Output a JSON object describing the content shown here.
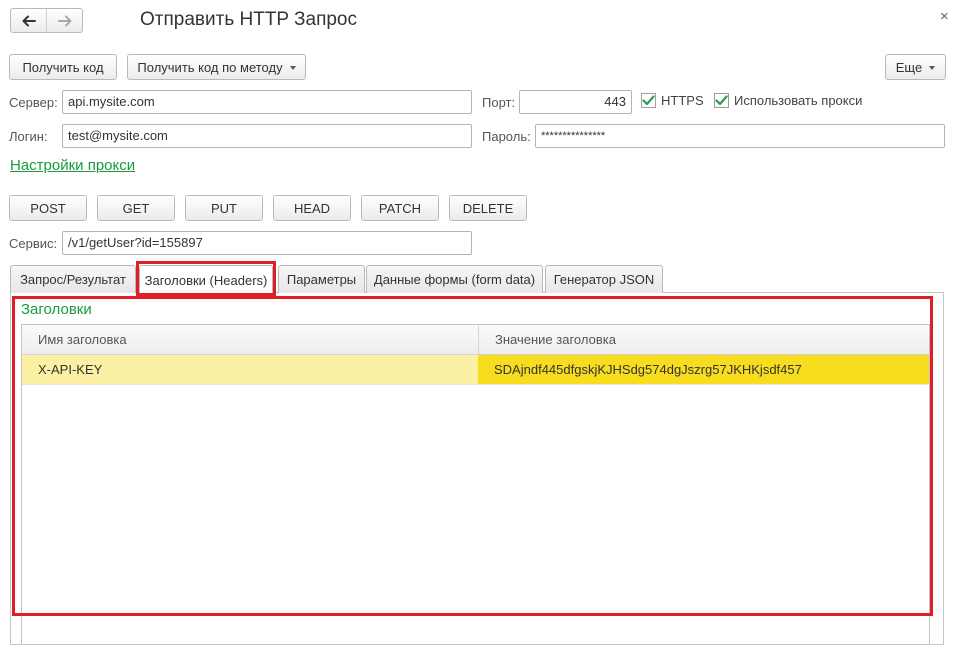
{
  "window": {
    "title": "Отправить HTTP Запрос",
    "close_glyph": "×",
    "back_icon": "arrow-left-icon",
    "forward_icon": "arrow-right-icon"
  },
  "toolbar": {
    "get_code": "Получить код",
    "get_code_by_method": "Получить код по методу",
    "more": "Еще"
  },
  "connection": {
    "server_label": "Сервер:",
    "server_value": "api.mysite.com",
    "port_label": "Порт:",
    "port_value": "443",
    "https_label": "HTTPS",
    "https_checked": true,
    "use_proxy_label": "Использовать прокси",
    "use_proxy_checked": true,
    "login_label": "Логин:",
    "login_value": "test@mysite.com",
    "password_label": "Пароль:",
    "password_value": "***************",
    "proxy_settings_link": "Настройки прокси"
  },
  "methods": [
    "POST",
    "GET",
    "PUT",
    "HEAD",
    "PATCH",
    "DELETE"
  ],
  "service": {
    "label": "Сервис:",
    "value": "/v1/getUser?id=155897"
  },
  "tabs": [
    {
      "label": "Запрос/Результат",
      "active": false
    },
    {
      "label": "Заголовки (Headers)",
      "active": true
    },
    {
      "label": "Параметры",
      "active": false
    },
    {
      "label": "Данные формы (form data)",
      "active": false
    },
    {
      "label": "Генератор JSON",
      "active": false
    }
  ],
  "headers_section": {
    "title": "Заголовки",
    "columns": [
      "Имя заголовка",
      "Значение заголовка"
    ],
    "rows": [
      {
        "name": "X-API-KEY",
        "value": "SDAjndf445dfgskjKJHSdg574dgJszrg57JKHKjsdf457"
      }
    ]
  },
  "colors": {
    "accent_green": "#1a9a3c",
    "highlight_red": "#e01e26",
    "row_selected": "#fbf0a3",
    "cell_selected": "#f8dc1e",
    "checkmark": "#2e9b4e"
  }
}
